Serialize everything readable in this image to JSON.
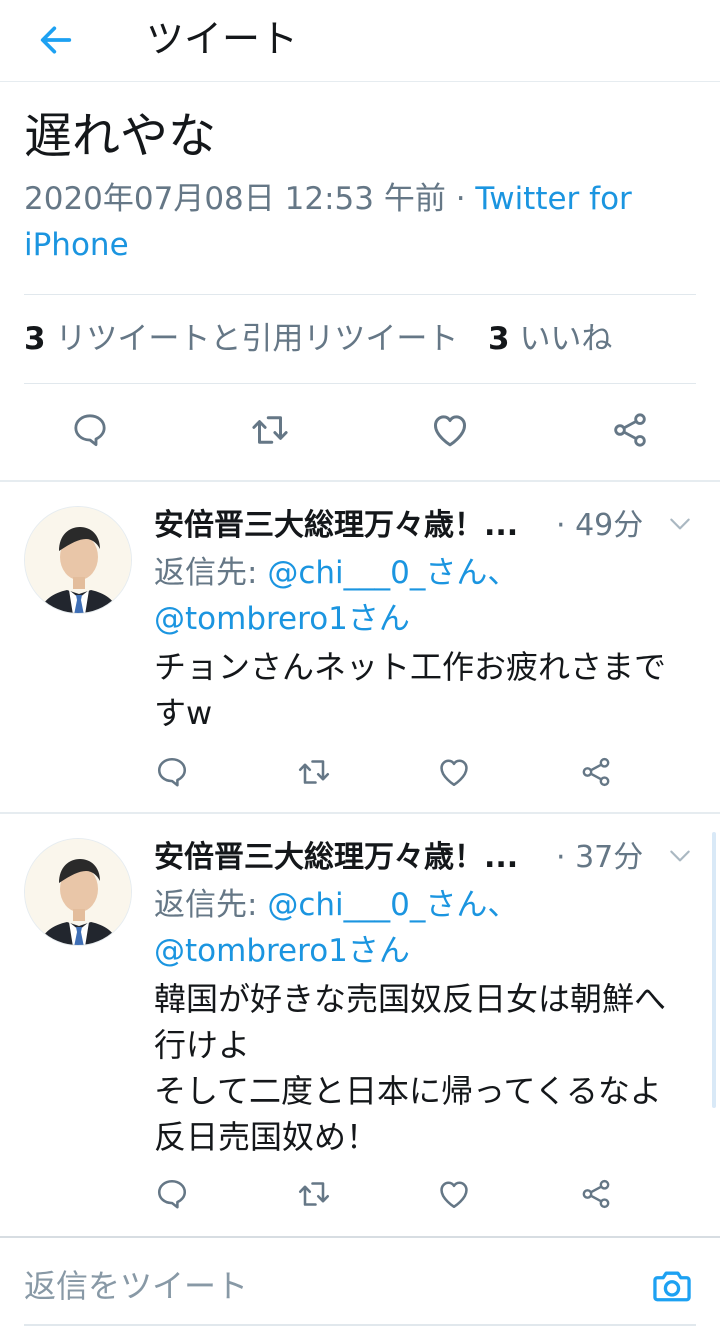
{
  "header": {
    "title": "ツイート",
    "back_icon": "arrow-left-icon",
    "accent": "#1da1f2"
  },
  "tweet": {
    "text_tail": "遅れやな",
    "date": "2020年07月08日 12:53 午前",
    "separator": " · ",
    "source": "Twitter for iPhone",
    "retweet_count": "3",
    "retweet_label": "リツイートと引用リツイート",
    "like_count": "3",
    "like_label": "いいね"
  },
  "replies": [
    {
      "name": "安倍晋三大総理万々歳！...",
      "time": "· 49分",
      "reply_prefix": "返信先: ",
      "handle1": "@chi___0_さん、",
      "handle2": "@tombrero1さん",
      "body": "チョンさんネット工作お疲れさまで\nすw"
    },
    {
      "name": "安倍晋三大総理万々歳！...",
      "time": "· 37分",
      "reply_prefix": "返信先: ",
      "handle1": "@chi___0_さん、",
      "handle2": "@tombrero1さん",
      "body": "韓国が好きな売国奴反日女は朝鮮へ\n行けよ\nそして二度と日本に帰ってくるなよ\n反日売国奴め！"
    }
  ],
  "reply_bar": {
    "placeholder": "返信をツイート"
  },
  "colors": {
    "link": "#1b95e0",
    "secondary": "#657786",
    "primary_text": "#14171a",
    "icon": "#657786"
  }
}
